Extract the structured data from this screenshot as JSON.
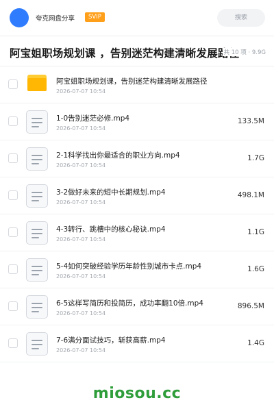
{
  "header": {
    "brand": "夸克网盘分享",
    "badge": "SVIP",
    "search_placeholder": "搜索"
  },
  "title": {
    "text": "阿宝姐职场规划课 ，告别迷茫构建清晰发展路径",
    "meta": "共 10 项 · 9.9G"
  },
  "files": [
    {
      "type": "folder",
      "name": "阿宝姐职场规划课，告别迷茫构建清晰发展路径",
      "date": "2026-07-07 10:54",
      "size": ""
    },
    {
      "type": "video",
      "name": "1-0告别迷茫必修.mp4",
      "date": "2026-07-07 10:54",
      "size": "133.5M"
    },
    {
      "type": "video",
      "name": "2-1科学找出你最适合的职业方向.mp4",
      "date": "2026-07-07 10:54",
      "size": "1.7G"
    },
    {
      "type": "video",
      "name": "3-2做好未来的短中长期规划.mp4",
      "date": "2026-07-07 10:54",
      "size": "498.1M"
    },
    {
      "type": "video",
      "name": "4-3转行、跳槽中的核心秘诀.mp4",
      "date": "2026-07-07 10:54",
      "size": "1.1G"
    },
    {
      "type": "video",
      "name": "5-4如何突破经验学历年龄性别城市卡点.mp4",
      "date": "2026-07-07 10:54",
      "size": "1.6G"
    },
    {
      "type": "video",
      "name": "6-5这样写简历和投简历，成功率翻10倍.mp4",
      "date": "2026-07-07 10:54",
      "size": "896.5M"
    },
    {
      "type": "video",
      "name": "7-6满分面试技巧，斩获高薪.mp4",
      "date": "2026-07-07 10:54",
      "size": "1.4G"
    }
  ],
  "watermark": "miosou.cc",
  "colors": {
    "accent": "#2f7cff",
    "badge": "#ff9f1a",
    "folder": "#ffb703",
    "watermark": "#2e9d3a"
  }
}
